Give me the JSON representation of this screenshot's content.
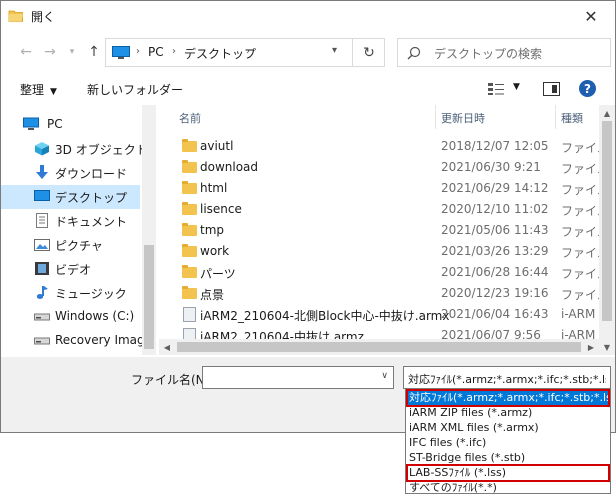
{
  "window": {
    "title": "開く"
  },
  "nav": {
    "address_root": "PC",
    "address_folder": "デスクトップ",
    "search_placeholder": "デスクトップの検索"
  },
  "toolbar": {
    "organize": "整理",
    "new_folder": "新しいフォルダー"
  },
  "sidebar": {
    "items": [
      {
        "label": "PC",
        "icon": "pc-icon"
      },
      {
        "label": "3D オブジェクト",
        "icon": "3d-objects-icon"
      },
      {
        "label": "ダウンロード",
        "icon": "download-icon"
      },
      {
        "label": "デスクトップ",
        "icon": "desktop-icon",
        "selected": true
      },
      {
        "label": "ドキュメント",
        "icon": "documents-icon"
      },
      {
        "label": "ピクチャ",
        "icon": "pictures-icon"
      },
      {
        "label": "ビデオ",
        "icon": "videos-icon"
      },
      {
        "label": "ミュージック",
        "icon": "music-icon"
      },
      {
        "label": "Windows (C:)",
        "icon": "drive-icon"
      },
      {
        "label": "Recovery Image",
        "icon": "drive-icon"
      }
    ]
  },
  "filelist": {
    "columns": {
      "name": "名前",
      "date": "更新日時",
      "type": "種類"
    },
    "rows": [
      {
        "name": "aviutl",
        "date": "2018/12/07 12:05",
        "type": "ファイル",
        "kind": "folder"
      },
      {
        "name": "download",
        "date": "2021/06/30 9:21",
        "type": "ファイル",
        "kind": "folder"
      },
      {
        "name": "html",
        "date": "2021/06/29 14:12",
        "type": "ファイル",
        "kind": "folder"
      },
      {
        "name": "lisence",
        "date": "2020/12/10 11:02",
        "type": "ファイル",
        "kind": "folder"
      },
      {
        "name": "tmp",
        "date": "2021/05/06 11:43",
        "type": "ファイル",
        "kind": "folder"
      },
      {
        "name": "work",
        "date": "2021/03/26 13:29",
        "type": "ファイル",
        "kind": "folder"
      },
      {
        "name": "パーツ",
        "date": "2021/06/28 16:44",
        "type": "ファイル",
        "kind": "folder"
      },
      {
        "name": "点景",
        "date": "2020/12/23 19:16",
        "type": "ファイル",
        "kind": "folder"
      },
      {
        "name": "iARM2_210604-北側Block中心-中抜け.armx",
        "date": "2021/06/04 16:43",
        "type": "i-ARM",
        "kind": "armz"
      },
      {
        "name": "iARM2_210604-中抜け.armz",
        "date": "2021/06/07 9:56",
        "type": "i-ARM",
        "kind": "armz"
      }
    ]
  },
  "bottom": {
    "filename_label": "ファイル名(N):",
    "filename_value": "",
    "filter_value": "対応ﾌｧｲﾙ(*.armz;*.armx;*.ifc;*.stb;*.lss)"
  },
  "dropdown": {
    "options": [
      {
        "label": "対応ﾌｧｲﾙ(*.armz;*.armx;*.ifc;*.stb;*.lss)",
        "selected": true,
        "marked": true
      },
      {
        "label": "iARM ZIP files (*.armz)"
      },
      {
        "label": "iARM XML files (*.armx)"
      },
      {
        "label": "IFC files (*.ifc)"
      },
      {
        "label": "ST-Bridge files (*.stb)"
      },
      {
        "label": "LAB-SSﾌｧｲﾙ (*.lss)",
        "marked": true
      },
      {
        "label": "すべてのﾌｧｲﾙ(*.*)"
      }
    ]
  },
  "colors": {
    "selection": "#cce8ff",
    "dropdown_selected": "#0078d7",
    "highlight_box": "#d00000",
    "folder": "#f3c34f",
    "accent": "#1f5fb0"
  }
}
